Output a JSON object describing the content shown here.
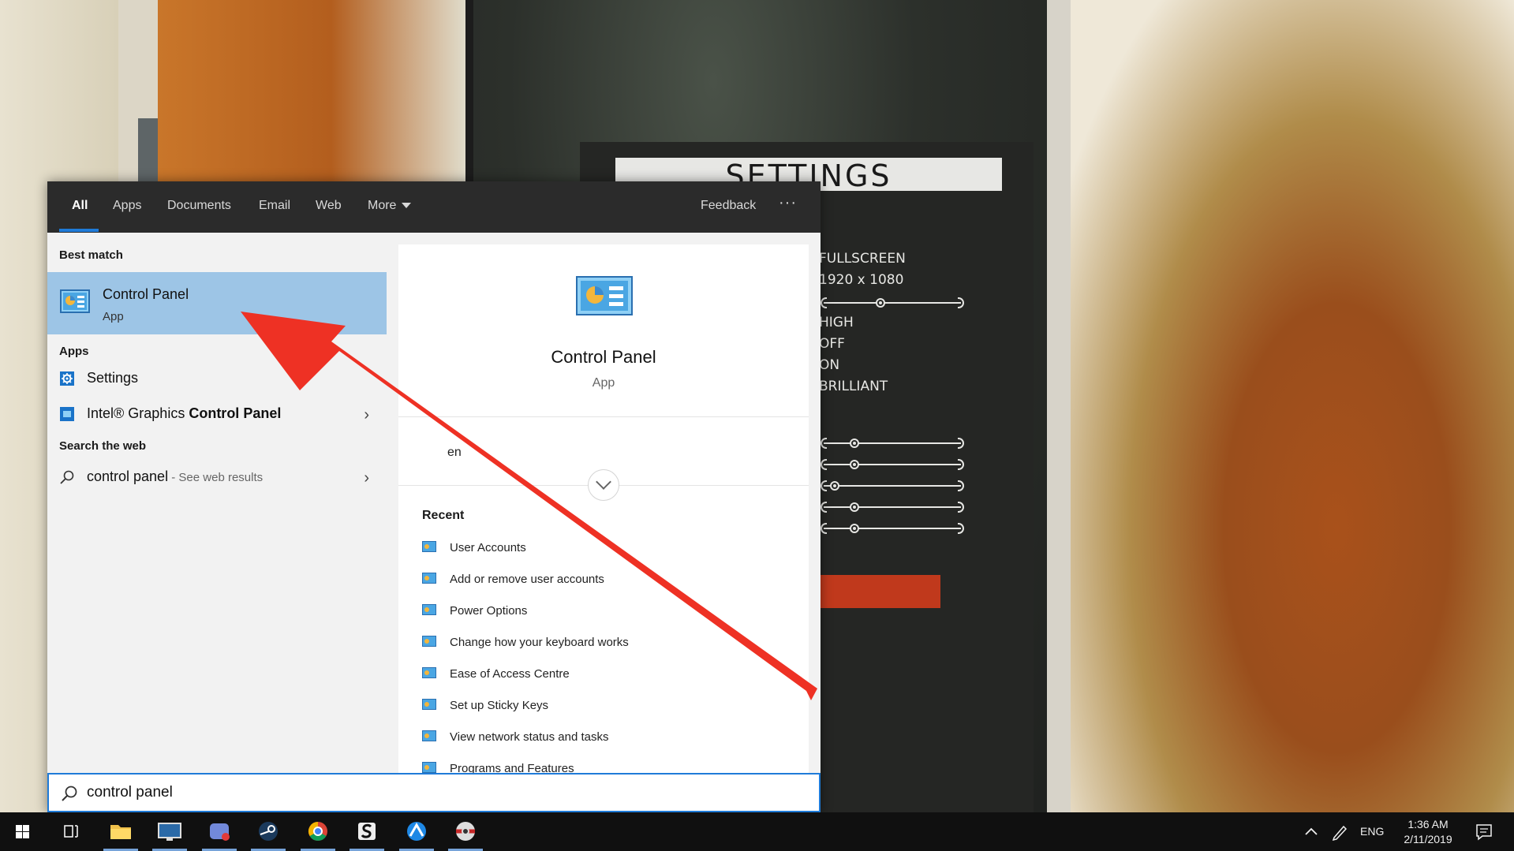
{
  "game": {
    "settings_title": "SETTINGS",
    "options": [
      "FULLSCREEN",
      "1920 x 1080",
      "HIGH",
      "OFF",
      "ON",
      "BRILLIANT"
    ],
    "slider_levels": [
      0.4,
      0.2,
      0.2,
      0.05,
      0.2,
      0.2
    ]
  },
  "search": {
    "tabs": [
      "All",
      "Apps",
      "Documents",
      "Email",
      "Web",
      "More"
    ],
    "active_tab": "All",
    "feedback_label": "Feedback",
    "more_options_label": "···",
    "best_match_heading": "Best match",
    "best_match": {
      "title": "Control Panel",
      "subtitle": "App"
    },
    "apps_heading": "Apps",
    "apps": [
      {
        "label": "Settings",
        "icon": "settings-gear-icon"
      },
      {
        "label": "Intel® Graphics ",
        "label_bold": "Control Panel",
        "icon": "intel-graphics-icon"
      }
    ],
    "web_heading": "Search the web",
    "web_result": {
      "query": "control panel",
      "hint": " - See web results"
    },
    "preview": {
      "title": "Control Panel",
      "subtitle": "App",
      "open_label": "en",
      "recent_heading": "Recent",
      "recent": [
        "User Accounts",
        "Add or remove user accounts",
        "Power Options",
        "Change how your keyboard works",
        "Ease of Access Centre",
        "Set up Sticky Keys",
        "View network status and tasks",
        "Programs and Features"
      ]
    },
    "input_value": "control panel"
  },
  "taskbar": {
    "apps": [
      "start-icon",
      "task-view-icon",
      "file-explorer-icon",
      "remote-desktop-icon",
      "discord-icon",
      "steam-icon",
      "chrome-icon",
      "app-s-icon",
      "app-blue-icon",
      "app-ball-icon"
    ],
    "language": "ENG",
    "time": "1:36 AM",
    "date": "2/11/2019"
  },
  "colors": {
    "accent": "#1f7bd8",
    "best_match_bg": "#9dc5e6",
    "arrow_red": "#ee3124"
  }
}
